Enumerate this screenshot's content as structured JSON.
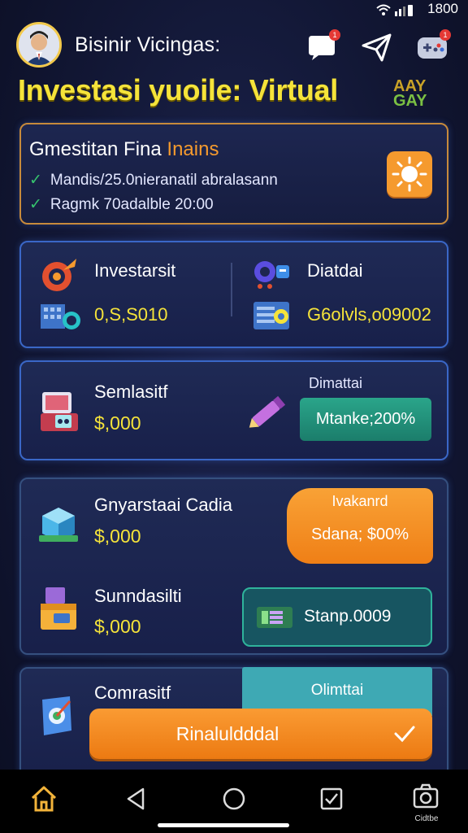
{
  "status_bar": {
    "time": "1800"
  },
  "header": {
    "app_name": "Bisinir Vicingas:",
    "banner_title": "Investasi yuoile: Virtual",
    "banner_badge_top": "AAY",
    "banner_badge_bottom": "GAY",
    "message_badge": "1",
    "game_badge": "1"
  },
  "card_intro": {
    "title_white": "Gmestitan Fina",
    "title_orange": "Inains",
    "lines": [
      "Mandis/25.0nieranatil abralasann",
      "Ragmk 70adalble 20:00"
    ]
  },
  "card_stats": {
    "left_label": "Investarsit",
    "left_value": "0,S,S010",
    "right_label": "Diatdai",
    "right_value": "G6olvls,o09002"
  },
  "card_semi": {
    "label": "Semlasitf",
    "value": "$,000",
    "side_label": "Dimattai",
    "pill_label": "Mtanke;200%"
  },
  "card_multi": {
    "item1_label": "Gnyarstaai Cadia",
    "item1_value": "$,000",
    "orange_top": "Ivakanrd",
    "orange_bottom": "Sdana; $00%",
    "item2_label": "Sunndasilti",
    "item2_value": "$,000",
    "teal_label": "Stanp.0009"
  },
  "card_bottom": {
    "label": "Comrasitf",
    "teal_label": "Olimttai",
    "cta_label": "Rinaluldddal"
  },
  "nav": {
    "camera_caption": "Cidtbe"
  }
}
